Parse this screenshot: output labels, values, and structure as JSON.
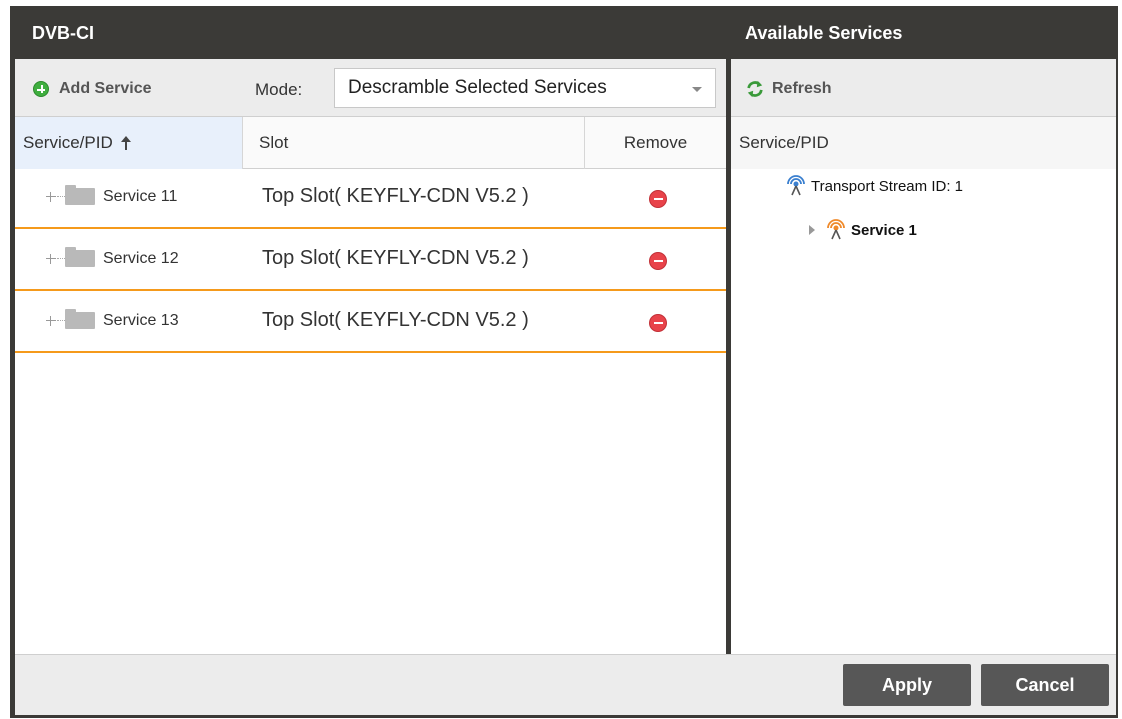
{
  "window": {
    "title_left": "DVB-CI",
    "title_right": "Available Services"
  },
  "left": {
    "add_service_label": "Add Service",
    "mode_label": "Mode:",
    "mode_value": "Descramble Selected Services",
    "columns": {
      "service": "Service/PID",
      "slot": "Slot",
      "remove": "Remove"
    },
    "rows": [
      {
        "service": "Service 11",
        "slot": "Top Slot( KEYFLY-CDN V5.2 )"
      },
      {
        "service": "Service 12",
        "slot": "Top Slot( KEYFLY-CDN V5.2 )"
      },
      {
        "service": "Service 13",
        "slot": "Top Slot( KEYFLY-CDN V5.2 )"
      }
    ]
  },
  "right": {
    "refresh_label": "Refresh",
    "column": "Service/PID",
    "tree": {
      "transport_stream": "Transport Stream ID: 1",
      "service": "Service 1"
    }
  },
  "footer": {
    "apply_label": "Apply",
    "cancel_label": "Cancel"
  },
  "colors": {
    "titlebar": "#3b3a37",
    "row_separator": "#f59a1b",
    "remove_icon": "#e8434a",
    "add_icon": "#3fae3f",
    "button": "#575757"
  }
}
